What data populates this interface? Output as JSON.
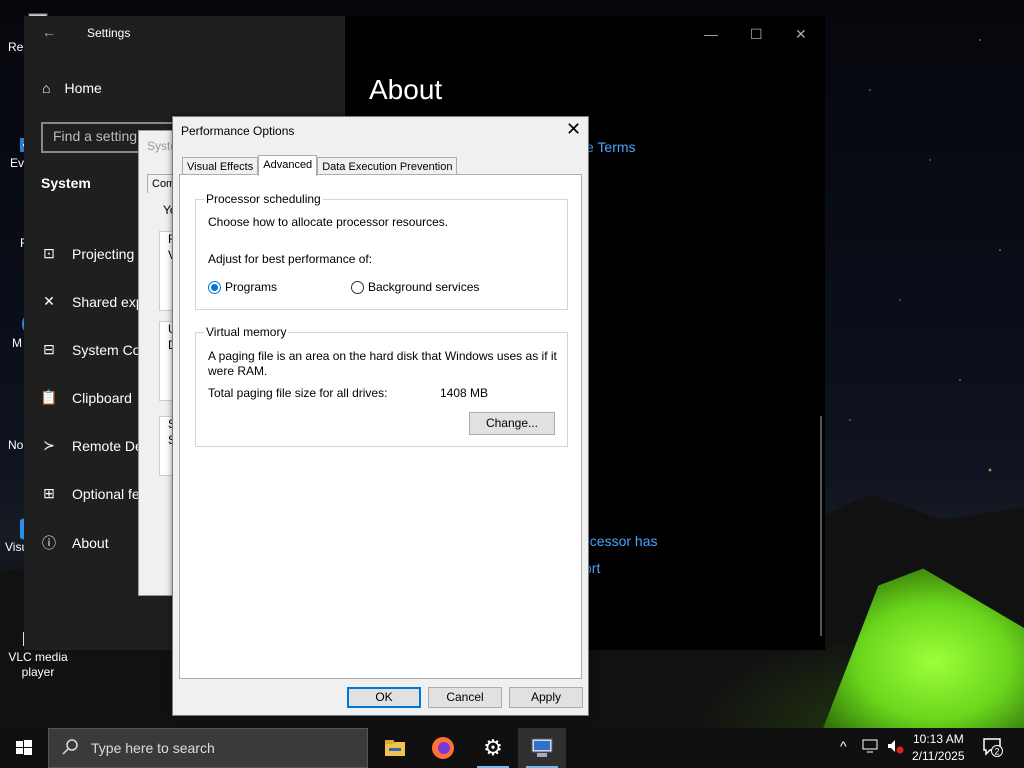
{
  "desktop": {
    "icons": [
      {
        "label": "Rec",
        "name": "recycle-bin-icon"
      },
      {
        "label": "Eve",
        "name": "everything-icon"
      },
      {
        "label": "F",
        "name": "firefox-shortcut-icon"
      },
      {
        "label": "M",
        "name": "edge-shortcut-icon"
      },
      {
        "label": "No",
        "name": "notepad-icon"
      },
      {
        "label": "Visu",
        "name": "visual-studio-icon"
      },
      {
        "label": "VLC media player",
        "name": "vlc-icon"
      }
    ]
  },
  "settings": {
    "title": "Settings",
    "home": "Home",
    "search_placeholder": "Find a setting",
    "section": "System",
    "nav": [
      "Projecting",
      "Shared exp",
      "System Co",
      "Clipboard",
      "Remote De",
      "Optional fe",
      "About"
    ],
    "page_title": "About",
    "link_terms": "e Terms",
    "link_processor": "ocessor has",
    "link_support": "ort"
  },
  "sysprops": {
    "title": "Syste",
    "tab": "Com",
    "letters": [
      "Yo",
      "F",
      "V",
      "U",
      "D",
      "S",
      "S"
    ]
  },
  "dialog": {
    "title": "Performance Options",
    "tabs": [
      "Visual Effects",
      "Advanced",
      "Data Execution Prevention"
    ],
    "active_tab": "Advanced",
    "processor": {
      "legend": "Processor scheduling",
      "desc": "Choose how to allocate processor resources.",
      "adjust": "Adjust for best performance of:",
      "options": [
        "Programs",
        "Background services"
      ],
      "selected": "Programs"
    },
    "vm": {
      "legend": "Virtual memory",
      "desc_line1": "A paging file is an area on the hard disk that Windows uses as if it",
      "desc_line2": "were RAM.",
      "total_label": "Total paging file size for all drives:",
      "total_value": "1408 MB",
      "change_btn": "Change..."
    },
    "buttons": {
      "ok": "OK",
      "cancel": "Cancel",
      "apply": "Apply"
    }
  },
  "taskbar": {
    "search_placeholder": "Type here to search",
    "apps": [
      "file-explorer-icon",
      "firefox-icon",
      "settings-icon",
      "system-properties-icon"
    ],
    "time": "10:13 AM",
    "date": "2/11/2025",
    "notifications": "2"
  }
}
